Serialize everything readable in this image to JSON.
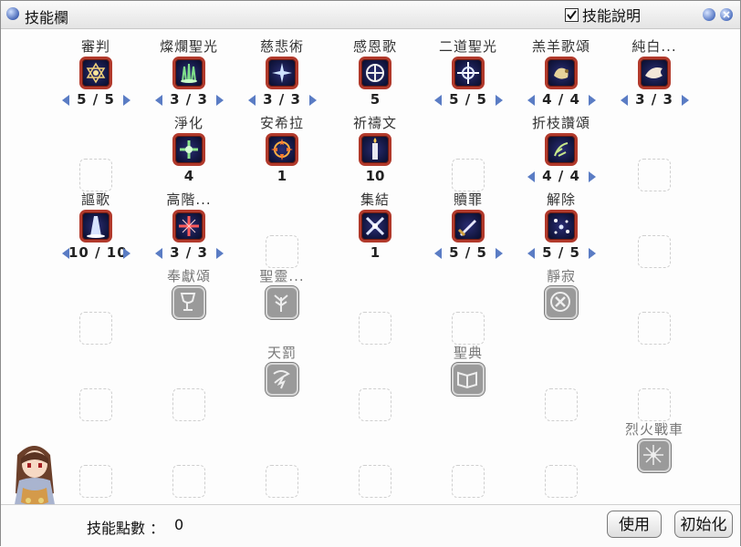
{
  "window": {
    "title": "技能欄",
    "show_description_label": "技能說明",
    "show_description_checked": true
  },
  "skills": [
    {
      "id": "judgement",
      "name": "審判",
      "state": "active",
      "level": "5 / 5",
      "has_arrows": true,
      "icon": "star-of-david-icon"
    },
    {
      "id": "magnificat",
      "name": "燦爛聖光",
      "state": "active",
      "level": "3 / 3",
      "has_arrows": true,
      "icon": "green-pillars-icon"
    },
    {
      "id": "compassion",
      "name": "慈悲術",
      "state": "active",
      "level": "3 / 3",
      "has_arrows": true,
      "icon": "sparkle-icon"
    },
    {
      "id": "gratitude",
      "name": "感恩歌",
      "state": "active",
      "level": "5",
      "has_arrows": false,
      "icon": "shield-icon"
    },
    {
      "id": "dual-light",
      "name": "二道聖光",
      "state": "active",
      "level": "5 / 5",
      "has_arrows": true,
      "icon": "quad-star-icon"
    },
    {
      "id": "lamb-hymn",
      "name": "羔羊歌頌",
      "state": "active",
      "level": "4 / 4",
      "has_arrows": true,
      "icon": "lamb-icon"
    },
    {
      "id": "pure-white",
      "name": "純白...",
      "state": "active",
      "level": "3 / 3",
      "has_arrows": true,
      "icon": "dove-icon"
    },
    {
      "id": "purify",
      "name": "淨化",
      "state": "active",
      "level": "4",
      "has_arrows": false,
      "icon": "green-cross-icon"
    },
    {
      "id": "ansila",
      "name": "安希拉",
      "state": "active",
      "level": "1",
      "has_arrows": false,
      "icon": "fire-burst-icon"
    },
    {
      "id": "prayer",
      "name": "祈禱文",
      "state": "active",
      "level": "10",
      "has_arrows": false,
      "icon": "candle-icon"
    },
    {
      "id": "palm-hymn",
      "name": "折枝讚頌",
      "state": "active",
      "level": "4 / 4",
      "has_arrows": true,
      "icon": "leaves-icon"
    },
    {
      "id": "chant",
      "name": "謳歌",
      "state": "active",
      "level": "10 / 10",
      "has_arrows": true,
      "icon": "light-pillar-icon"
    },
    {
      "id": "high-heal",
      "name": "高階...",
      "state": "active",
      "level": "3 / 3",
      "has_arrows": true,
      "icon": "red-cross-icon"
    },
    {
      "id": "assemble",
      "name": "集結",
      "state": "active",
      "level": "1",
      "has_arrows": false,
      "icon": "cross-burst-icon"
    },
    {
      "id": "redemption",
      "name": "贖罪",
      "state": "active",
      "level": "5 / 5",
      "has_arrows": true,
      "icon": "sword-icon"
    },
    {
      "id": "dispel",
      "name": "解除",
      "state": "active",
      "level": "5 / 5",
      "has_arrows": true,
      "icon": "dispel-stars-icon"
    },
    {
      "id": "offering",
      "name": "奉獻頌",
      "state": "locked",
      "level": "",
      "has_arrows": false,
      "icon": "chalice-icon"
    },
    {
      "id": "holy-spirit",
      "name": "聖靈...",
      "state": "locked",
      "level": "",
      "has_arrows": false,
      "icon": "tree-icon"
    },
    {
      "id": "silence",
      "name": "靜寂",
      "state": "locked",
      "level": "",
      "has_arrows": false,
      "icon": "cross-circle-icon"
    },
    {
      "id": "divine-punish",
      "name": "天罰",
      "state": "locked",
      "level": "",
      "has_arrows": false,
      "icon": "storm-icon"
    },
    {
      "id": "scripture",
      "name": "聖典",
      "state": "locked",
      "level": "",
      "has_arrows": false,
      "icon": "book-icon"
    },
    {
      "id": "fire-chariot",
      "name": "烈火戰車",
      "state": "locked",
      "level": "",
      "has_arrows": false,
      "icon": "spark-icon"
    }
  ],
  "footer": {
    "points_label": "技能點數 ：",
    "points_value": "0",
    "use_label": "使用",
    "reset_label": "初始化"
  },
  "colors": {
    "frame_active": "#b23a2c",
    "icon_bg": "#141844",
    "arrow": "#5a7cc4",
    "locked": "#9a9a9a"
  }
}
